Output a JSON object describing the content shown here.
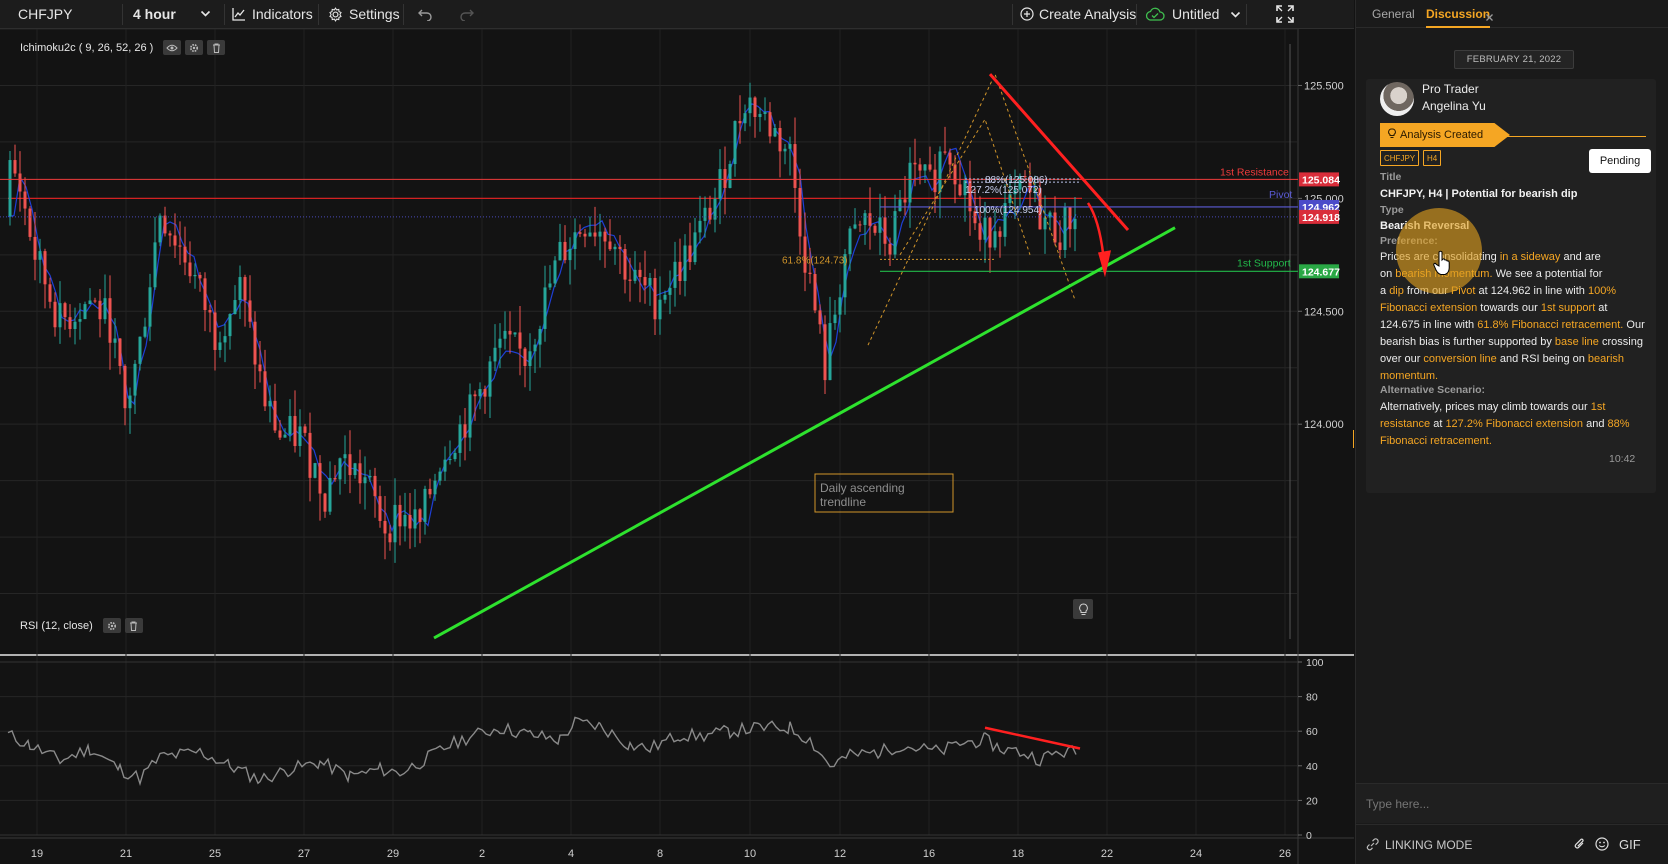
{
  "toolbar": {
    "symbol": "CHFJPY",
    "interval": "4 hour",
    "indicators_label": "Indicators",
    "settings_label": "Settings",
    "create_analysis_label": "Create Analysis",
    "layout_label": "Untitled",
    "icons": {
      "dropdown": "chevron-down-icon",
      "indicators": "chart-line-icon",
      "settings": "gear-icon",
      "undo": "undo-icon",
      "redo": "redo-icon",
      "create": "plus-circle-icon",
      "cloud": "cloud-check-icon",
      "fullscreen": "fullscreen-icon"
    }
  },
  "main_legend": {
    "label": "Ichimoku2c ( 9, 26, 52, 26 )",
    "icons": [
      "eye-icon",
      "gear-icon",
      "trash-icon"
    ]
  },
  "rsi_legend": {
    "label": "RSI (12, close)",
    "icons": [
      "gear-icon",
      "trash-icon"
    ]
  },
  "chart_data": [
    {
      "type": "candlestick",
      "symbol": "CHFJPY",
      "interval": "4 hour",
      "price_ticks": [
        "125.500",
        "125.000",
        "124.500",
        "124.000"
      ],
      "price_ticks_values": [
        125.5,
        125.0,
        124.5,
        124.0
      ],
      "ylim": [
        123.0,
        125.75
      ],
      "x_tick_labels": [
        "19",
        "21",
        "25",
        "27",
        "29",
        "2",
        "4",
        "8",
        "10",
        "12",
        "16",
        "18",
        "22",
        "24",
        "26"
      ],
      "price_tags": [
        {
          "label": "1st Resistance",
          "value": "125.084",
          "color": "#ef3b3b"
        },
        {
          "label": "Pivot",
          "value": "124.962",
          "color": "#5b5bd6"
        },
        {
          "label": "",
          "value": "124.918",
          "color": "#e23a4a"
        },
        {
          "label": "1st Support",
          "value": "124.677",
          "color": "#22b84a"
        }
      ],
      "fib_labels": [
        "88%(125.086)",
        "127.2%(125.072)",
        "100%(124.954)",
        "61.8%(124.73)"
      ],
      "annotation": "Daily ascending trendline",
      "series": [
        {
          "name": "price",
          "color": "#26a69a"
        },
        {
          "name": "conversion line",
          "color": "#1e3fd6"
        },
        {
          "name": "base line",
          "color": "#d32222"
        }
      ]
    },
    {
      "type": "line",
      "title": "RSI (12, close)",
      "y_ticks": [
        "100",
        "80",
        "60",
        "40",
        "20",
        "0"
      ],
      "y_ticks_values": [
        100,
        80,
        60,
        40,
        20,
        0
      ],
      "ylim": [
        0,
        100
      ],
      "series": [
        {
          "name": "RSI",
          "color": "#8a8a8a"
        }
      ]
    }
  ],
  "panel": {
    "tab_general": "General",
    "tab_discussion": "Discussion",
    "close_icon": "close-icon",
    "date": "FEBRUARY 21, 2022",
    "author_role": "Pro Trader",
    "author_name": "Angelina Yu",
    "status": "Analysis Created",
    "status_icon": "lightbulb-icon",
    "tags": [
      "CHFJPY",
      "H4"
    ],
    "pending_label": "Pending",
    "title_label": "Title",
    "title_value": "CHFJPY, H4 | Potential for bearish dip",
    "type_label": "Type",
    "type_value": "Bearish Reversal",
    "preference_label": "Preference:",
    "preference_lines": [
      [
        {
          "t": "Prices are consolidating "
        },
        {
          "t": "in a sideway",
          "h": true
        },
        {
          "t": " and are"
        }
      ],
      [
        {
          "t": "on "
        },
        {
          "t": "bearish momentum.",
          "h": true
        },
        {
          "t": " We see a potential for"
        }
      ],
      [
        {
          "t": "a "
        },
        {
          "t": "dip",
          "h": true
        },
        {
          "t": " from our "
        },
        {
          "t": "Pivot",
          "h": true
        },
        {
          "t": " at 124.962 in line with "
        },
        {
          "t": "100%",
          "h": true
        }
      ],
      [
        {
          "t": "Fibonacci extension",
          "h": true
        },
        {
          "t": " towards our "
        },
        {
          "t": "1st support",
          "h": true
        },
        {
          "t": " at"
        }
      ],
      [
        {
          "t": "124.675 in line with "
        },
        {
          "t": "61.8% Fibonacci retracement.",
          "h": true
        },
        {
          "t": " Our"
        }
      ],
      [
        {
          "t": "bearish bias is further supported by "
        },
        {
          "t": "base line",
          "h": true
        },
        {
          "t": " crossing"
        }
      ],
      [
        {
          "t": "over our "
        },
        {
          "t": "conversion line",
          "h": true
        },
        {
          "t": " and RSI being on "
        },
        {
          "t": "bearish",
          "h": true
        }
      ],
      [
        {
          "t": "momentum.",
          "h": true
        }
      ]
    ],
    "alt_label": "Alternative Scenario:",
    "alt_lines": [
      [
        {
          "t": "Alternatively, prices may climb towards our "
        },
        {
          "t": "1st",
          "h": true
        }
      ],
      [
        {
          "t": "resistance",
          "h": true
        },
        {
          "t": " at "
        },
        {
          "t": "127.2% Fibonacci extension",
          "h": true
        },
        {
          "t": " and "
        },
        {
          "t": "88%",
          "h": true
        }
      ],
      [
        {
          "t": "Fibonacci retracement.",
          "h": true
        }
      ]
    ],
    "time": "10:42",
    "input_placeholder": "Type here...",
    "linking_mode": "LINKING MODE",
    "gif_label": "GIF"
  }
}
